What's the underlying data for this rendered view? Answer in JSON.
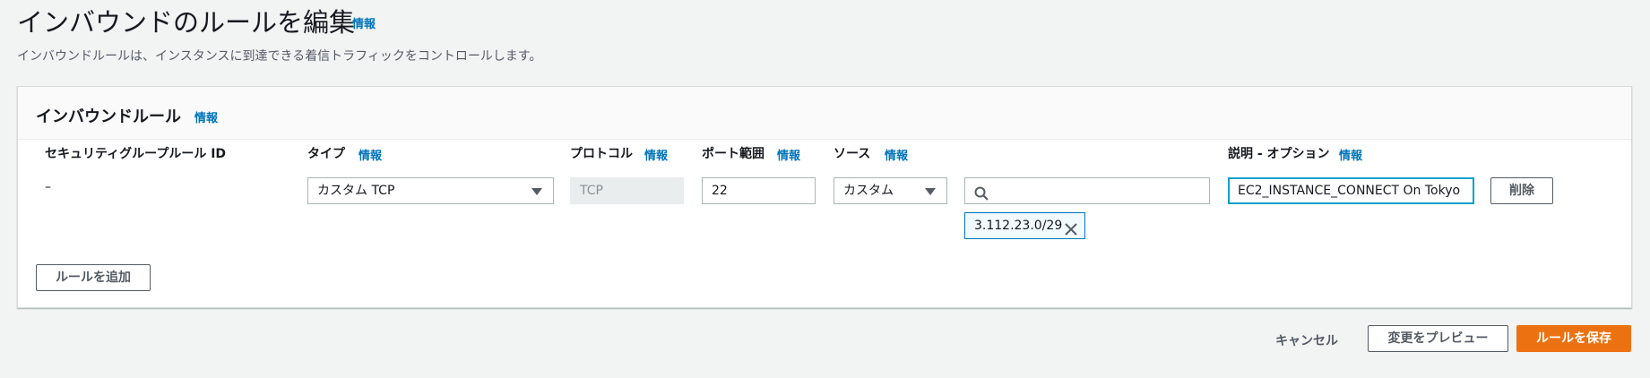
{
  "page": {
    "title": "インバウンドのルールを編集",
    "title_info": "情報",
    "description": "インバウンドルールは、インスタンスに到達できる着信トラフィックをコントロールします。"
  },
  "panel": {
    "title": "インバウンドルール",
    "title_info": "情報"
  },
  "columns": {
    "rule_id": "セキュリティグループルール ID",
    "type": "タイプ",
    "type_info": "情報",
    "protocol": "プロトコル",
    "protocol_info": "情報",
    "port_range": "ポート範囲",
    "port_range_info": "情報",
    "source": "ソース",
    "source_info": "情報",
    "description": "説明 - オプション",
    "description_info": "情報"
  },
  "rule": {
    "rule_id": "–",
    "type": "カスタム TCP",
    "protocol": "TCP",
    "port_range": "22",
    "source_type": "カスタム",
    "source_search_value": "",
    "source_token": "3.112.23.0/29",
    "description": "EC2_INSTANCE_CONNECT On Tokyo",
    "delete_label": "削除"
  },
  "add_rule_label": "ルールを追加",
  "footer": {
    "cancel_label": "キャンセル",
    "preview_label": "変更をプレビュー",
    "save_label": "ルールを保存"
  },
  "colors": {
    "accent": "#ec7211",
    "link": "#0073bb",
    "focus": "#00a1c9"
  }
}
